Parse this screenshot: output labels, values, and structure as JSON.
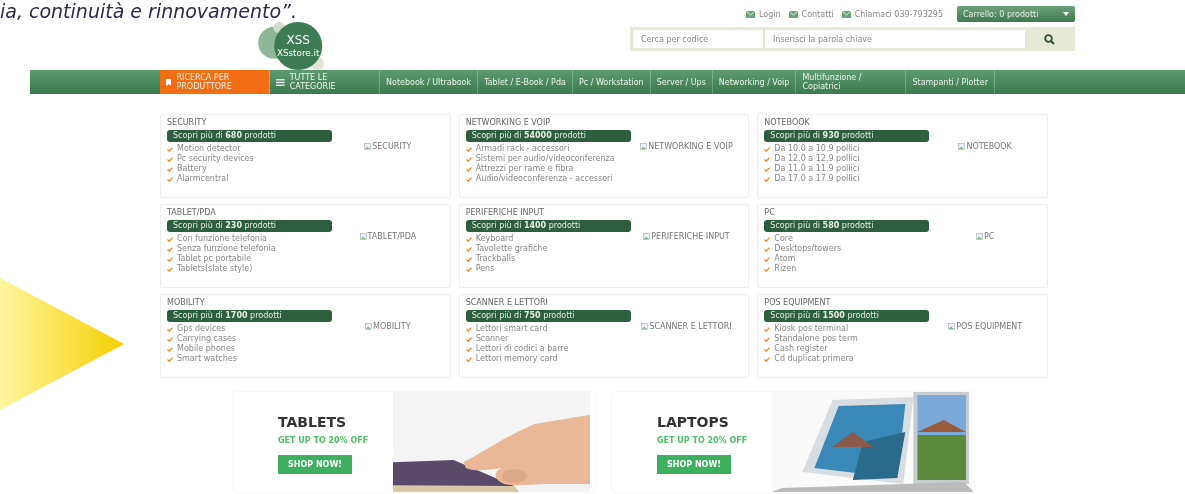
{
  "slide_caption": "ia, continuità e rinnovamento”.",
  "header": {
    "logo": {
      "mark": "XSS",
      "site": "XSstore.it"
    },
    "top_links": [
      {
        "label": "Login"
      },
      {
        "label": "Contatti"
      },
      {
        "label": "Chiamaci 039-793295"
      }
    ],
    "cart": "Carrello: 0 prodotti",
    "search": {
      "code_placeholder": "Cerca per codice",
      "keyword_placeholder": "Inserisci la parola chiave"
    }
  },
  "nav": [
    {
      "label": "RICERCA PER PRODUTTORE",
      "kind": "bookmark",
      "selected": true
    },
    {
      "label": "TUTTE LE CATEGORIE",
      "kind": "menu",
      "selected": false
    },
    {
      "label": "Notebook / Ultrabook",
      "kind": "plain",
      "selected": false
    },
    {
      "label": "Tablet / E-Book / Pda",
      "kind": "plain",
      "selected": false
    },
    {
      "label": "Pc / Workstation",
      "kind": "plain",
      "selected": false
    },
    {
      "label": "Server / Ups",
      "kind": "plain",
      "selected": false
    },
    {
      "label": "Networking / Voip",
      "kind": "plain",
      "selected": false
    },
    {
      "label": "Multifunzione / Copiatrici",
      "kind": "plain",
      "selected": false
    },
    {
      "label": "Stampanti / Plotter",
      "kind": "plain",
      "selected": false
    }
  ],
  "categories": [
    {
      "title": "SECURITY",
      "cta": "Scopri più di **680** prodotti",
      "items": [
        "Motion detector",
        "Pc security devices",
        "Battery",
        "Alarmcentral"
      ],
      "image_alt": "SECURITY"
    },
    {
      "title": "NETWORKING E VOIP",
      "cta": "Scopri più di **54000** prodotti",
      "items": [
        "Armadi rack - accessori",
        "Sistemi per audio/videoconferenza",
        "Attrezzi per rame e fibra",
        "Audio/videoconferenza - accessori"
      ],
      "image_alt": "NETWORKING E VOIP"
    },
    {
      "title": "NOTEBOOK",
      "cta": "Scopri più di **930** prodotti",
      "items": [
        "Da 10.0 a 10.9 pollici",
        "Da 12.0 a 12.9 pollici",
        "Da 11.0 a 11.9 pollici",
        "Da 17.0 a 17.9 pollici"
      ],
      "image_alt": "NOTEBOOK"
    },
    {
      "title": "TABLET/PDA",
      "cta": "Scopri più di **230** prodotti",
      "items": [
        "Con funzione telefonia",
        "Senza funzione telefonia",
        "Tablet pc portabile",
        "Tablets(slate style)"
      ],
      "image_alt": "TABLET/PDA"
    },
    {
      "title": "PERIFERICHE INPUT",
      "cta": "Scopri più di **1400** prodotti",
      "items": [
        "Keyboard",
        "Tavolette grafiche",
        "Trackballs",
        "Pens"
      ],
      "image_alt": "PERIFERICHE INPUT"
    },
    {
      "title": "PC",
      "cta": "Scopri più di **580** prodotti",
      "items": [
        "Core",
        "Desktops/towers",
        "Atom",
        "Rizen"
      ],
      "image_alt": "PC"
    },
    {
      "title": "MOBILITY",
      "cta": "Scopri più di **1700** prodotti",
      "items": [
        "Gps devices",
        "Carrying cases",
        "Mobile phones",
        "Smart watches"
      ],
      "image_alt": "MOBILITY"
    },
    {
      "title": "SCANNER E LETTORI",
      "cta": "Scopri più di **750** prodotti",
      "items": [
        "Lettori smart card",
        "Scanner",
        "Lettori di codici a barre",
        "Lettori memory card"
      ],
      "image_alt": "SCANNER E LETTORI"
    },
    {
      "title": "POS EQUIPMENT",
      "cta": "Scopri più di **1500** prodotti",
      "items": [
        "Kiosk pos terminal",
        "Standalone pos term",
        "Cash register",
        "Cd duplicat primera"
      ],
      "image_alt": "POS EQUIPMENT"
    }
  ],
  "banners": [
    {
      "title": "TABLETS",
      "offer": "GET UP TO 20% OFF",
      "button": "SHOP NOW!",
      "kind": "tablet"
    },
    {
      "title": "LAPTOPS",
      "offer": "GET UP TO 20% OFF",
      "button": "SHOP NOW!",
      "kind": "laptop"
    }
  ]
}
